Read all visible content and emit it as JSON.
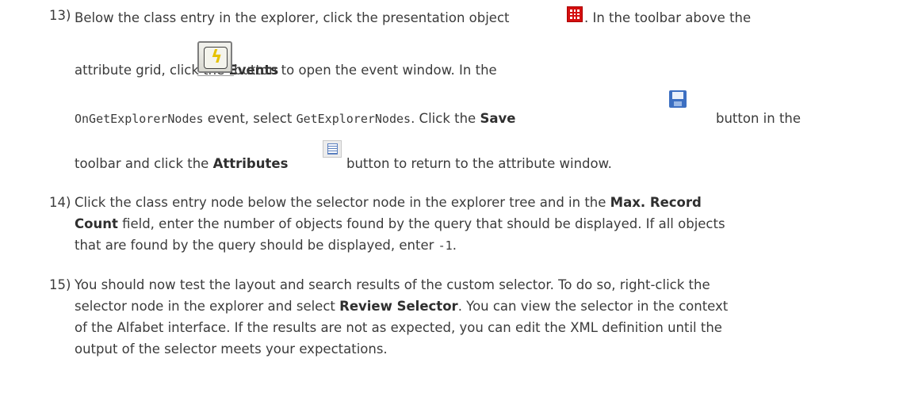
{
  "steps": [
    {
      "number": "13)",
      "lines": [
        {
          "t1": "Below the class entry in the explorer, click the presentation object",
          "t2": ". In the toolbar above the"
        },
        {
          "t1": "attribute grid, click the ",
          "b1": "Events",
          "t2": " button to open the event window. In the"
        },
        {
          "c1": "OnGetExplorerNodes",
          "t1": " event, select ",
          "c2": "GetExplorerNodes",
          "t2": ". Click the ",
          "b1": "Save",
          "t3": "button in the"
        },
        {
          "t1": "toolbar and click the ",
          "b1": "Attributes",
          "t2": " button to return to the attribute window."
        }
      ]
    },
    {
      "number": "14)",
      "lines": [
        {
          "t1": "Click the class entry node below the selector node in the explorer tree and in the ",
          "b1": "Max. Record"
        },
        {
          "b1": "Count",
          "t1": " field, enter the number of objects found by the query that should be displayed. If all objects"
        },
        {
          "t1": "that are found by the query should be displayed, enter ",
          "c1": "-1",
          "t2": "."
        }
      ]
    },
    {
      "number": "15)",
      "lines": [
        {
          "t1": "You should now test the layout and search results of the custom selector. To do so, right-click the"
        },
        {
          "t1": "selector node in the explorer and select ",
          "b1": "Review Selector",
          "t2": ". You can view the selector in the context"
        },
        {
          "t1": "of the Alfabet interface. If the results are not as expected, you can edit the XML definition until the"
        },
        {
          "t1": "output of the selector meets your expectations."
        }
      ]
    }
  ],
  "icons": {
    "presentation": "presentation-object-icon",
    "events": "events-lightning-icon",
    "save": "floppy-save-icon",
    "attributes": "attributes-list-icon"
  }
}
